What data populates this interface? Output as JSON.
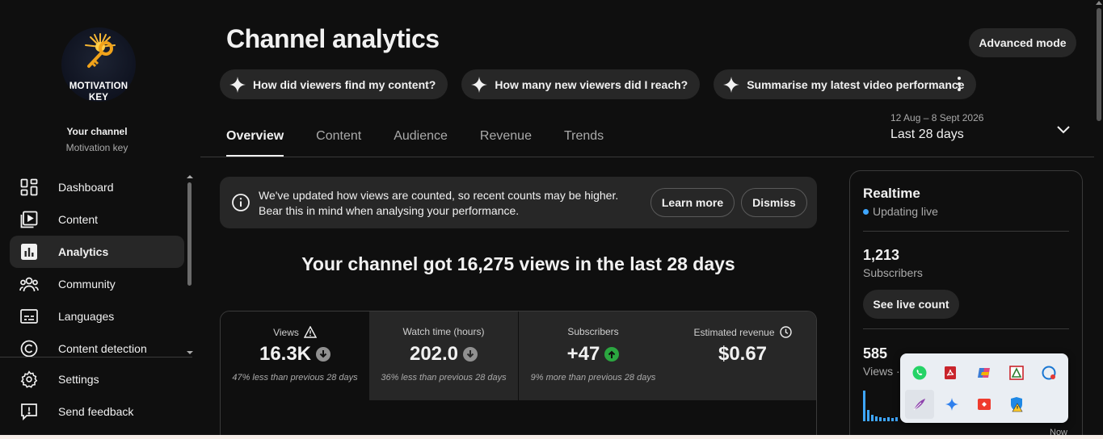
{
  "channel": {
    "logo_text_line1": "MOTIVATION",
    "logo_text_line2": "KEY",
    "title": "Your channel",
    "name": "Motivation key"
  },
  "sidebar": {
    "items": [
      {
        "label": "Dashboard",
        "icon": "dashboard-icon"
      },
      {
        "label": "Content",
        "icon": "content-icon"
      },
      {
        "label": "Analytics",
        "icon": "analytics-icon",
        "active": true
      },
      {
        "label": "Community",
        "icon": "community-icon"
      },
      {
        "label": "Languages",
        "icon": "languages-icon"
      },
      {
        "label": "Content detection",
        "icon": "copyright-icon"
      }
    ],
    "bottom_items": [
      {
        "label": "Settings",
        "icon": "gear-icon"
      },
      {
        "label": "Send feedback",
        "icon": "feedback-icon"
      }
    ]
  },
  "header": {
    "title": "Channel analytics",
    "advanced_mode_label": "Advanced mode"
  },
  "chips": [
    {
      "label": "How did viewers find my content?"
    },
    {
      "label": "How many new viewers did I reach?"
    },
    {
      "label": "Summarise my latest video performance"
    }
  ],
  "tabs": [
    {
      "label": "Overview",
      "active": true
    },
    {
      "label": "Content"
    },
    {
      "label": "Audience"
    },
    {
      "label": "Revenue"
    },
    {
      "label": "Trends"
    }
  ],
  "date_range": {
    "range": "12 Aug – 8 Sept 2026",
    "label": "Last 28 days"
  },
  "notice": {
    "line1": "We've updated how views are counted, so recent counts may be higher.",
    "line2": "Bear this in mind when analysing your performance.",
    "learn_more_label": "Learn more",
    "dismiss_label": "Dismiss"
  },
  "headline": "Your channel got 16,275 views in the last 28 days",
  "metrics": [
    {
      "label": "Views",
      "value": "16.3K",
      "note": "47% less than previous 28 days",
      "trend": "down",
      "label_icon": "warning-icon"
    },
    {
      "label": "Watch time (hours)",
      "value": "202.0",
      "note": "36% less than previous 28 days",
      "trend": "down"
    },
    {
      "label": "Subscribers",
      "value": "+47",
      "note": "9% more than previous 28 days",
      "trend": "up"
    },
    {
      "label": "Estimated revenue",
      "value": "$0.67",
      "note": "",
      "label_icon": "clock-icon"
    }
  ],
  "realtime": {
    "title": "Realtime",
    "status": "Updating live",
    "subscribers_value": "1,213",
    "subscribers_label": "Subscribers",
    "see_live_label": "See live count",
    "views_value": "585",
    "views_label": "Views ·",
    "now_label": "Now"
  },
  "colors": {
    "background": "#0f0f0f",
    "surface": "#272727",
    "accent_blue": "#3ea6ff",
    "trend_up": "#2ba640",
    "trend_down": "#909090"
  },
  "tray_icons": [
    "whatsapp-icon",
    "pdf-reader-icon",
    "copilot-icon",
    "pdf-tool-icon",
    "meet-icon",
    "feather-icon",
    "sparkle-icon",
    "anydesk-icon",
    "defender-warning-icon"
  ]
}
